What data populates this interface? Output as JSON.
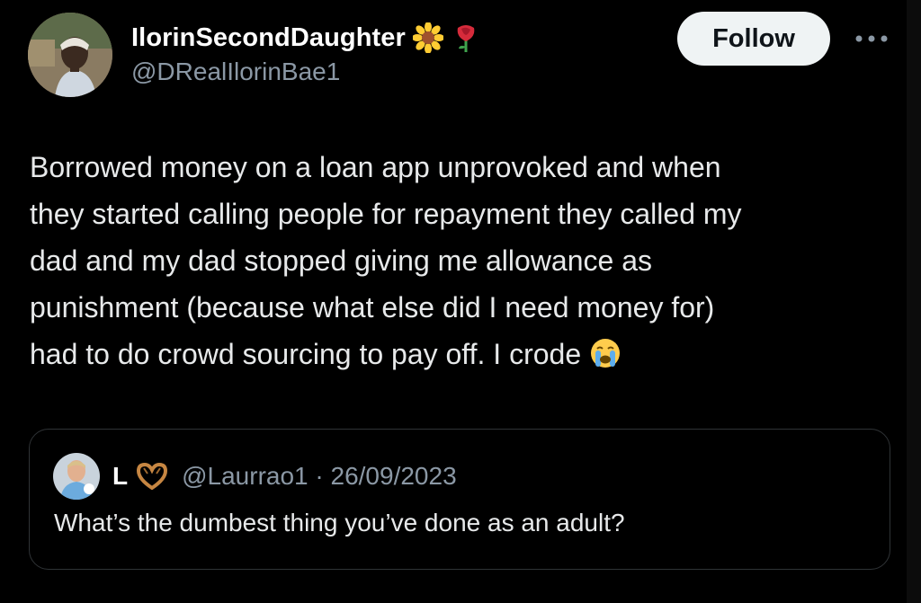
{
  "author": {
    "display_name": "IlorinSecondDaughter",
    "handle": "@DRealIlorinBae1",
    "name_emojis": [
      "sunflower-icon",
      "rose-icon"
    ]
  },
  "actions": {
    "follow_label": "Follow",
    "more_icon": "more-dots-icon"
  },
  "tweet": {
    "text": "Borrowed money on a loan app unprovoked and when\nthey started calling people for repayment they called my\ndad and my dad stopped giving me allowance as\npunishment (because what else did I need money for)\nhad to do crowd sourcing to pay off. I crode",
    "trailing_emoji": "loudly-crying-face-icon"
  },
  "quote": {
    "display_name": "L",
    "name_emoji": "heart-hands-icon",
    "handle_date": "@Laurrao1 · 26/09/2023",
    "text": "What’s the dumbest thing you’ve done as an adult?"
  },
  "colors": {
    "background": "#000000",
    "primary_text": "#e7e9ea",
    "secondary_text": "#8b98a5",
    "follow_bg": "#eff3f4",
    "border": "#2f3336"
  }
}
